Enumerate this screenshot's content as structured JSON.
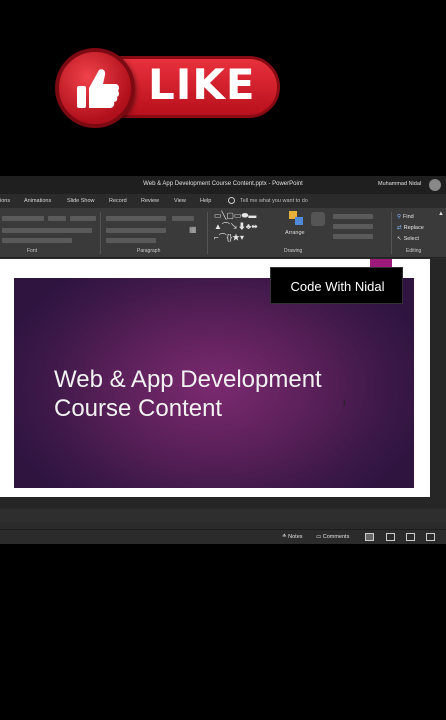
{
  "like_badge": {
    "label": "LIKE",
    "icon": "thumbs-up-icon"
  },
  "window": {
    "title": "Web & App Development Course Content.pptx  -  PowerPoint",
    "user_name": "Muhammad Nidal"
  },
  "menu": {
    "items": [
      "ions",
      "Animations",
      "Slide Show",
      "Record",
      "Review",
      "View",
      "Help"
    ],
    "tell_me": "Tell me what you want to do"
  },
  "ribbon": {
    "groups": [
      "Font",
      "Paragraph",
      "Drawing",
      "Editing"
    ],
    "arrange_label": "Arrange",
    "editing": {
      "find": "Find",
      "replace": "Replace",
      "select": "Select"
    }
  },
  "slide": {
    "title_line1": "Web & App Development",
    "title_line2": "Course Content",
    "background": "#5a2059"
  },
  "watermark": "Code With Nidal",
  "status": {
    "notes": "Notes",
    "comments": "Comments"
  },
  "colors": {
    "like_red": "#d81f2c",
    "slide_purple": "#5a2059",
    "accent_magenta": "#9c1b7a"
  }
}
